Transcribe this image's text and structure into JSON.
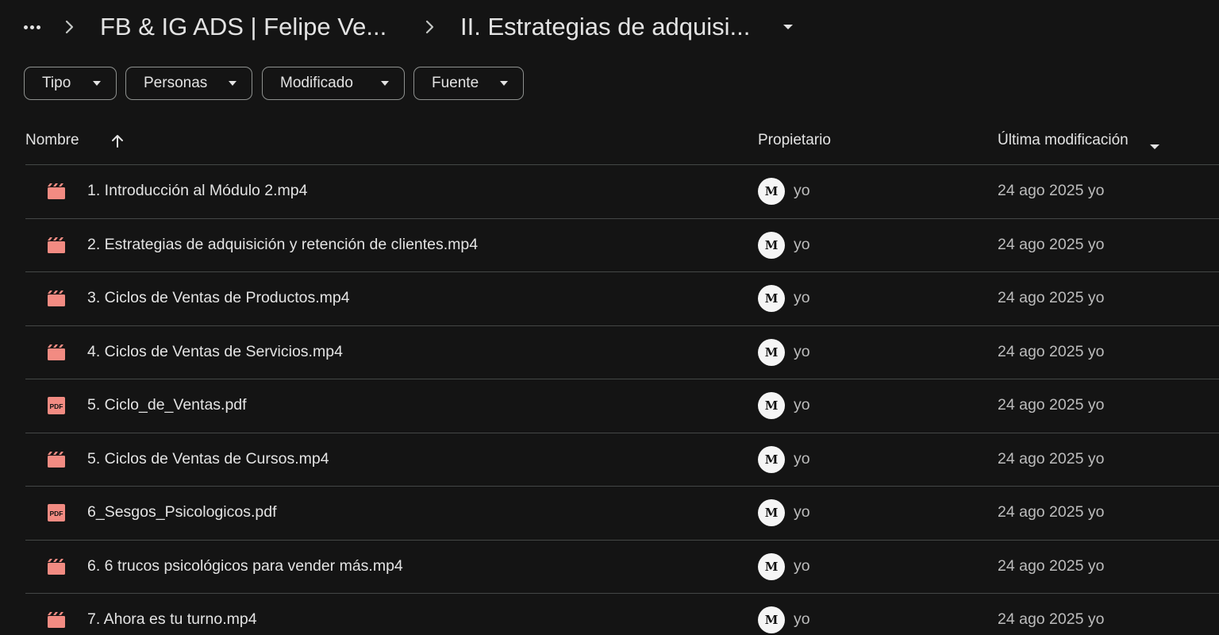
{
  "breadcrumb": {
    "more_icon": "more-horiz-icon",
    "items": [
      {
        "label": "FB & IG ADS | Felipe Ve..."
      },
      {
        "label": "II. Estrategias de adquisi..."
      }
    ]
  },
  "filters": [
    {
      "label": "Tipo"
    },
    {
      "label": "Personas"
    },
    {
      "label": "Modificado"
    },
    {
      "label": "Fuente"
    }
  ],
  "table": {
    "columns": {
      "name": "Nombre",
      "owner": "Propietario",
      "modified": "Última modificación"
    },
    "rows": [
      {
        "type": "video",
        "name": "1. Introducción al Módulo 2.mp4",
        "owner": "yo",
        "modified": "24 ago 2025 yo"
      },
      {
        "type": "video",
        "name": "2. Estrategias de adquisición y retención de clientes.mp4",
        "owner": "yo",
        "modified": "24 ago 2025 yo"
      },
      {
        "type": "video",
        "name": "3. Ciclos de Ventas de Productos.mp4",
        "owner": "yo",
        "modified": "24 ago 2025 yo"
      },
      {
        "type": "video",
        "name": "4. Ciclos de Ventas de Servicios.mp4",
        "owner": "yo",
        "modified": "24 ago 2025 yo"
      },
      {
        "type": "pdf",
        "name": "5. Ciclo_de_Ventas.pdf",
        "owner": "yo",
        "modified": "24 ago 2025 yo"
      },
      {
        "type": "video",
        "name": "5. Ciclos de Ventas de Cursos.mp4",
        "owner": "yo",
        "modified": "24 ago 2025 yo"
      },
      {
        "type": "pdf",
        "name": "6_Sesgos_Psicologicos.pdf",
        "owner": "yo",
        "modified": "24 ago 2025 yo"
      },
      {
        "type": "video",
        "name": "6. 6 trucos psicológicos para vender más.mp4",
        "owner": "yo",
        "modified": "24 ago 2025 yo"
      },
      {
        "type": "video",
        "name": "7. Ahora es tu turno.mp4",
        "owner": "yo",
        "modified": "24 ago 2025 yo"
      }
    ]
  },
  "colors": {
    "background": "#141414",
    "file_icon": "#f28b82",
    "divider": "#444746"
  }
}
